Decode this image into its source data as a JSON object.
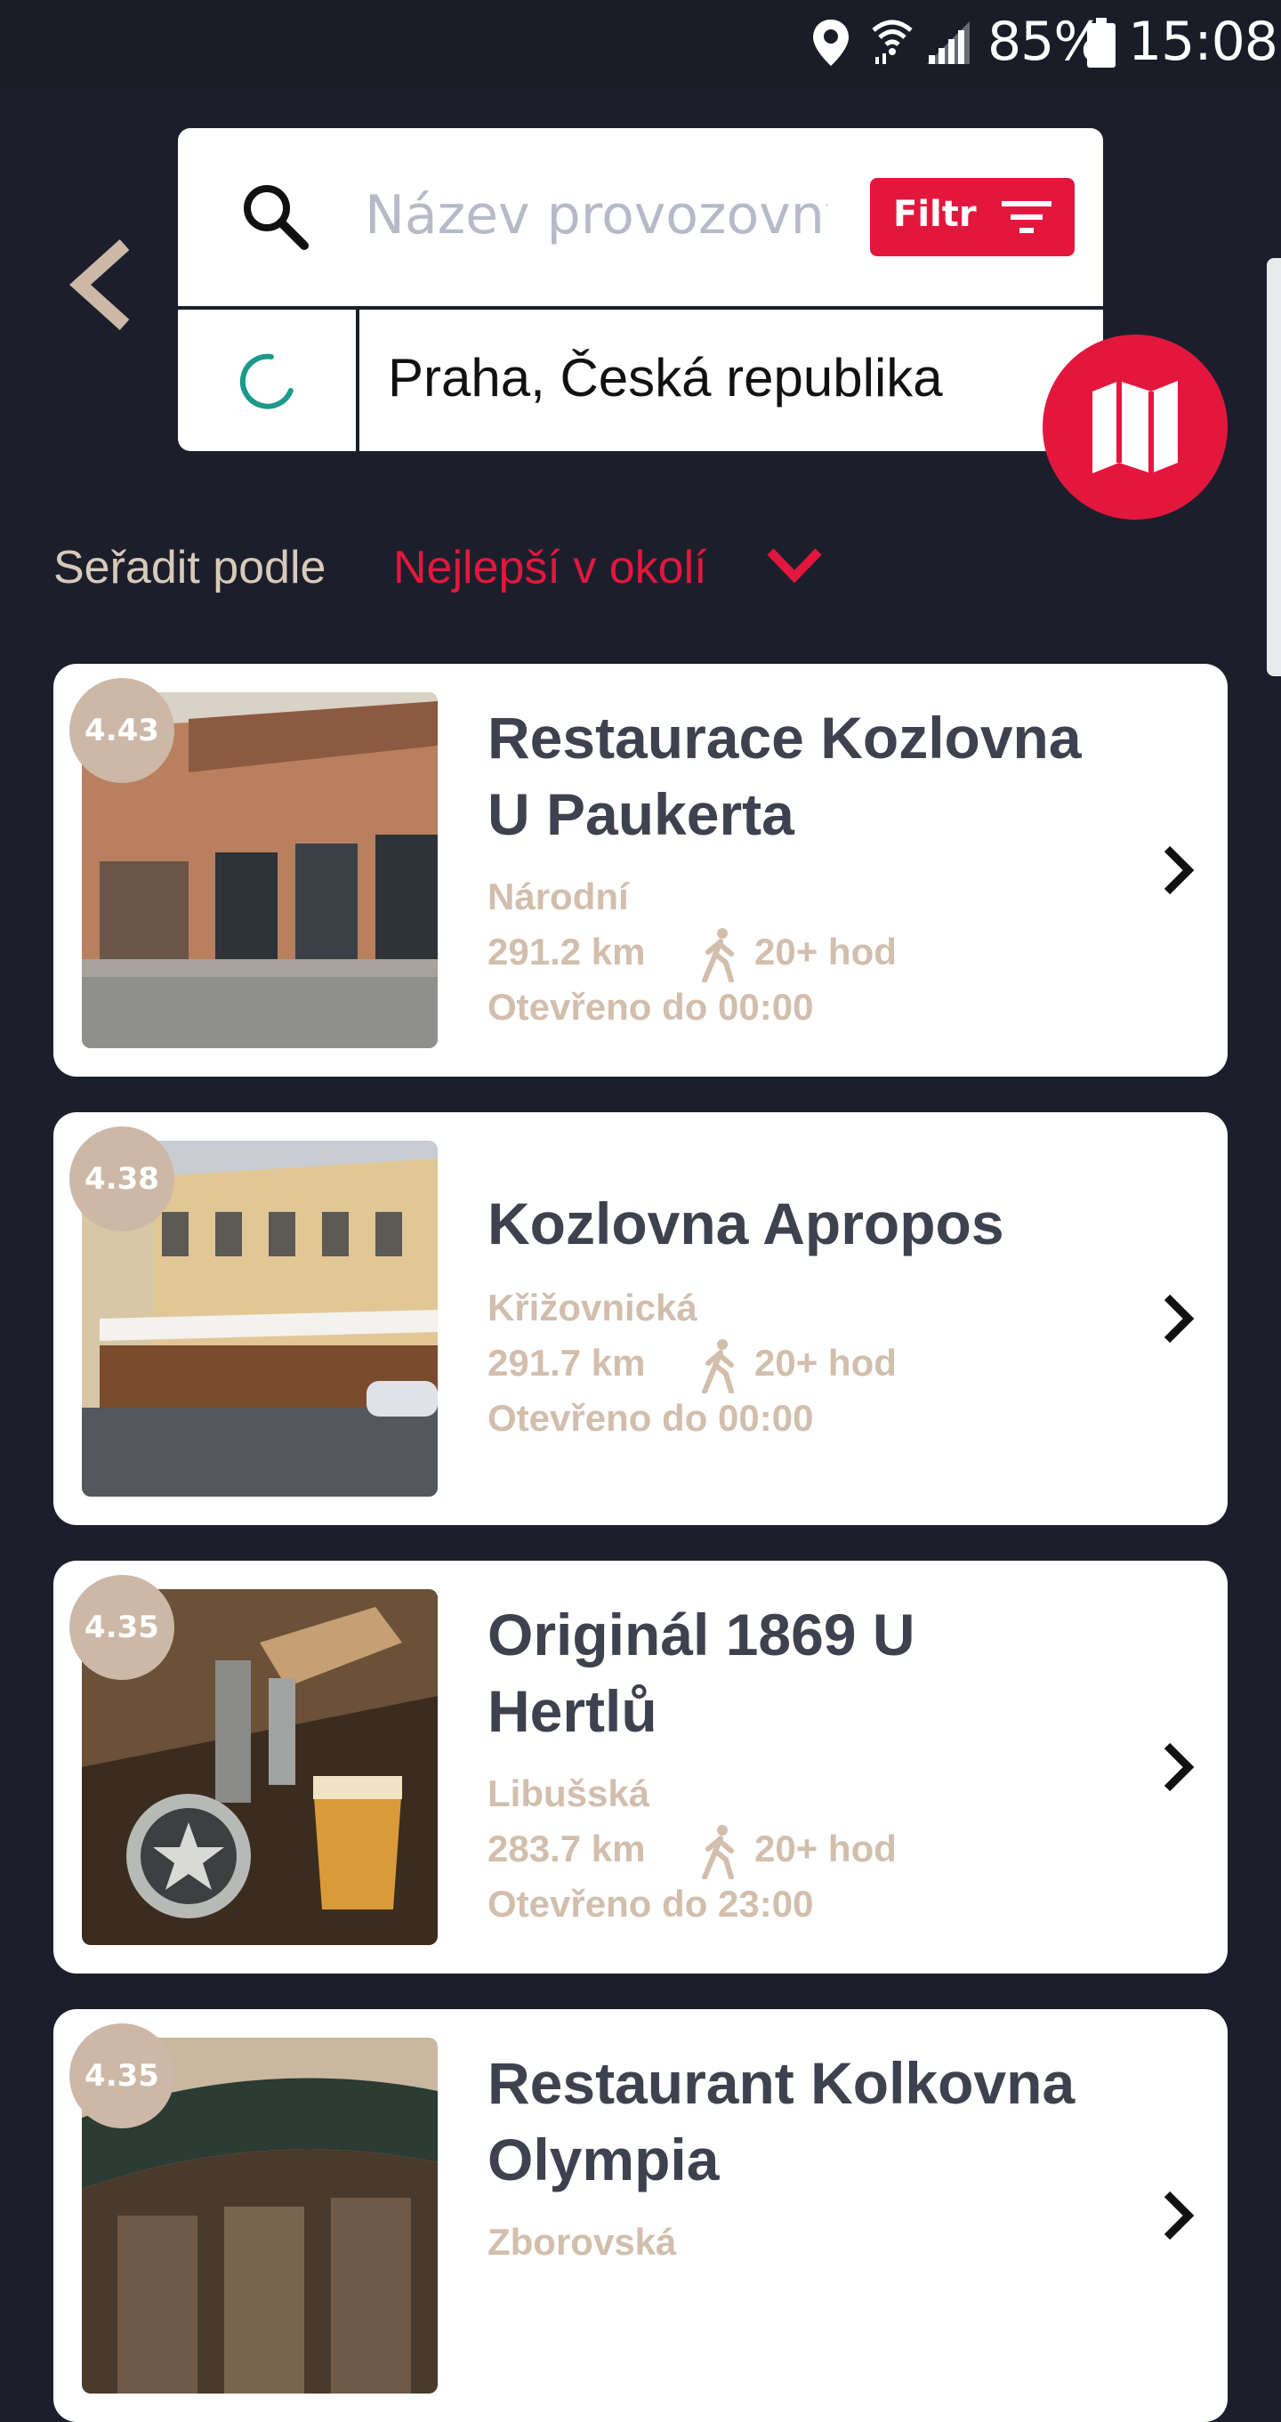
{
  "status_bar": {
    "battery": "85%",
    "time": "15:08",
    "icons": [
      "location-icon",
      "wifi-icon",
      "signal-icon",
      "battery-icon"
    ]
  },
  "search": {
    "placeholder": "Název provozovny",
    "filter_label": "Filtr",
    "location": "Praha, Česká republika"
  },
  "sort": {
    "label": "Seřadit podle",
    "value": "Nejlepší v okolí"
  },
  "colors": {
    "background": "#1c1f2b",
    "accent": "#e3173e",
    "badge": "#cdb8a7",
    "meta_text": "#d2beac",
    "title_text": "#3e414e",
    "loader": "#1a9a8a"
  },
  "venues": [
    {
      "rating": "4.43",
      "name_line1": "Restaurace Kozlovna",
      "name_line2": "U Paukerta",
      "street": "Národní",
      "distance": "291.2 km",
      "walk": "20+ hod",
      "hours": "Otevřeno do 00:00"
    },
    {
      "rating": "4.38",
      "name_line1": "Kozlovna Apropos",
      "name_line2": "",
      "street": "Křižovnická",
      "distance": "291.7 km",
      "walk": "20+ hod",
      "hours": "Otevřeno do 00:00"
    },
    {
      "rating": "4.35",
      "name_line1": "Originál 1869 U",
      "name_line2": "Hertlů",
      "street": "Libušská",
      "distance": "283.7 km",
      "walk": "20+ hod",
      "hours": "Otevřeno do 23:00"
    },
    {
      "rating": "4.35",
      "name_line1": "Restaurant Kolkovna",
      "name_line2": "Olympia",
      "street": "Zborovská",
      "distance": "",
      "walk": "",
      "hours": ""
    }
  ]
}
